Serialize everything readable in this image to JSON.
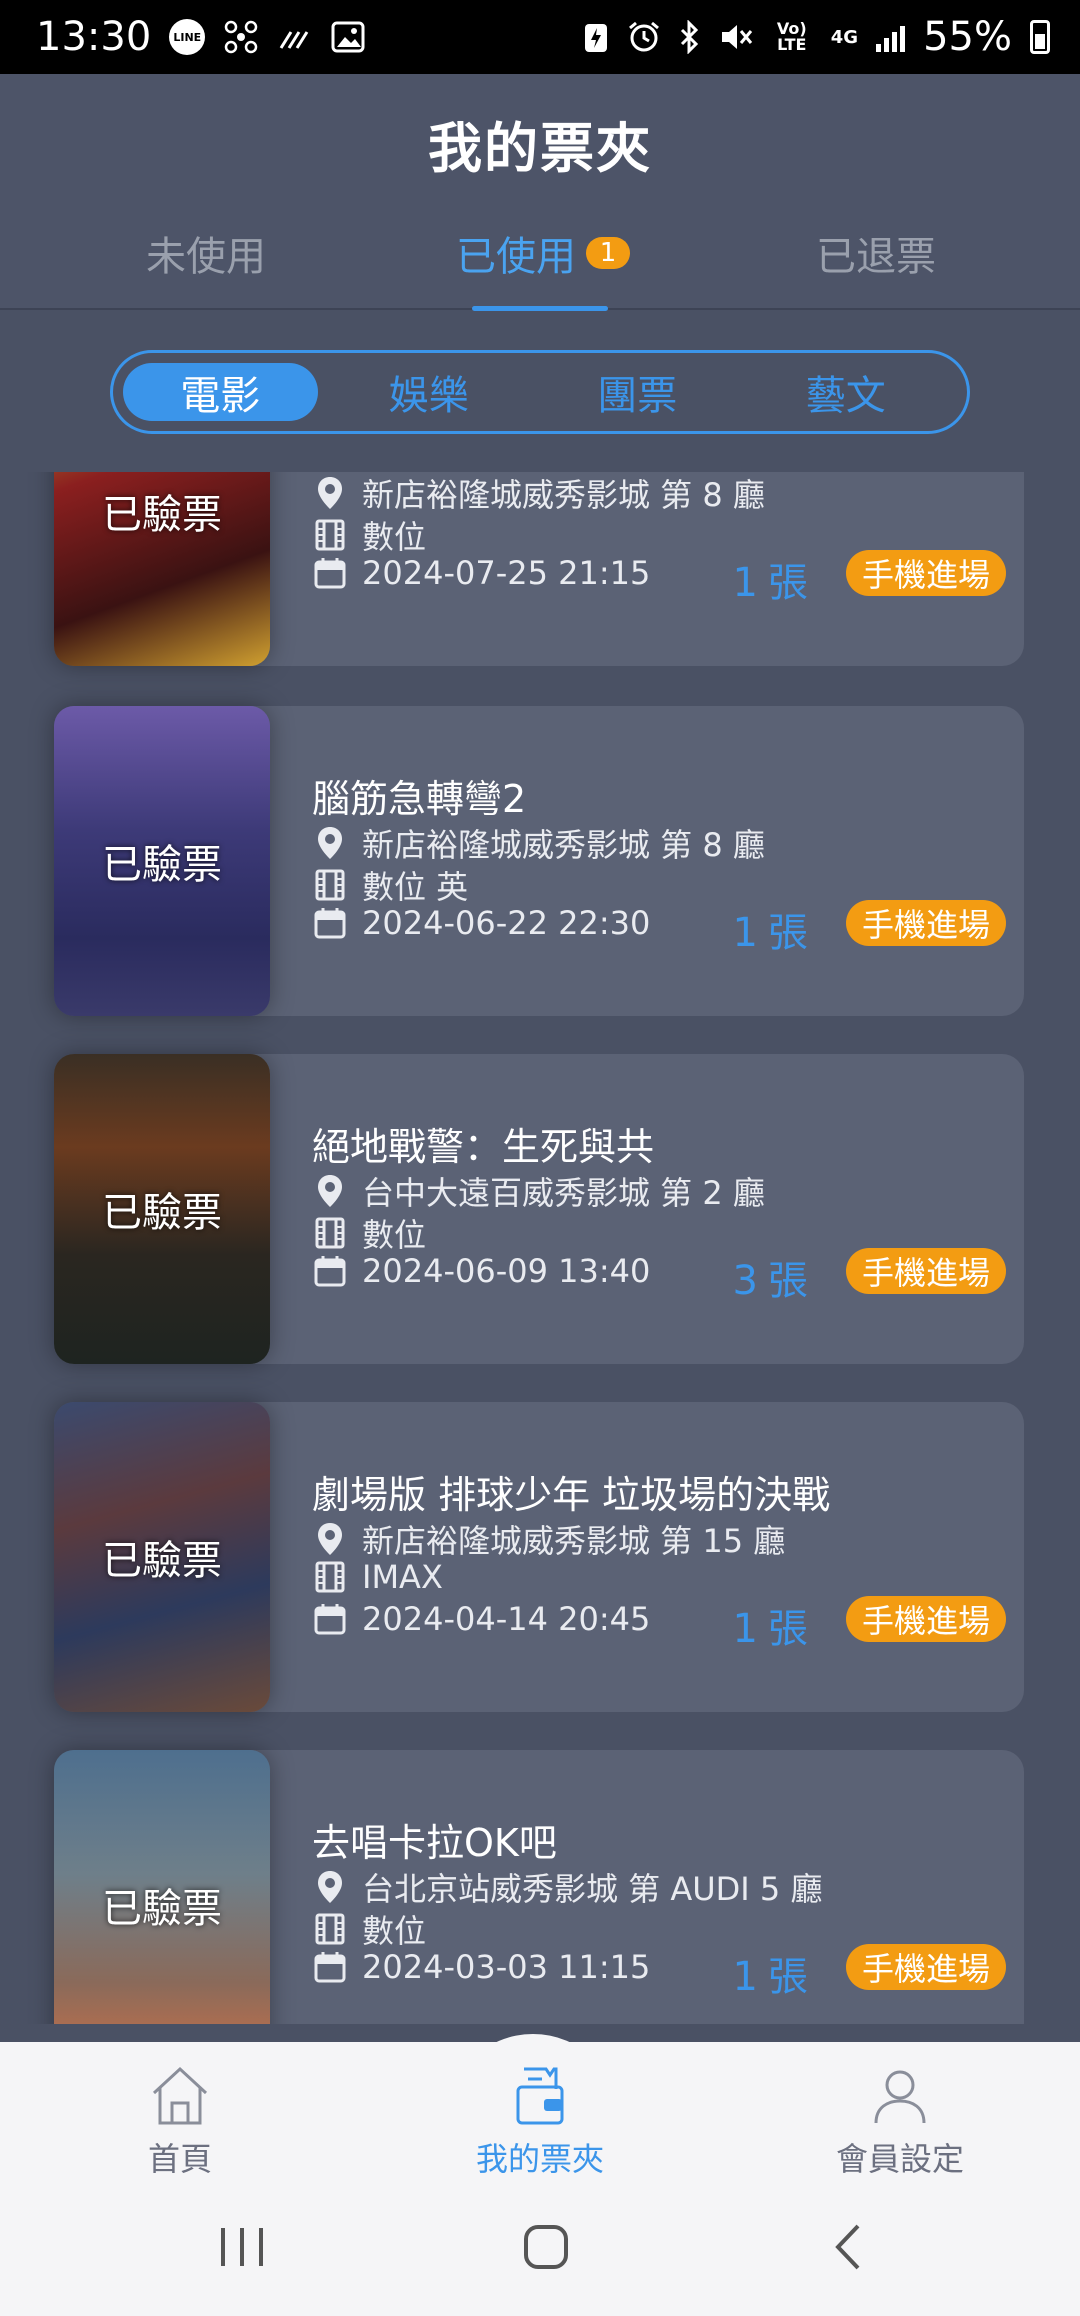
{
  "status_bar": {
    "time": "13:30",
    "line_label": "LINE",
    "battery_percent": "55%",
    "network_type": "4G",
    "volte_label": "Vo) LTE",
    "icons": [
      "line-icon",
      "drone-icon",
      "missed-call-icon",
      "image-icon",
      "battery-saver-icon",
      "alarm-icon",
      "bluetooth-icon",
      "mute-icon",
      "volte-icon",
      "network-4g-icon",
      "signal-icon",
      "battery-icon"
    ]
  },
  "header": {
    "title": "我的票夾",
    "tabs": [
      {
        "label": "未使用"
      },
      {
        "label": "已使用",
        "badge": "1"
      },
      {
        "label": "已退票"
      }
    ],
    "active_tab": "已使用"
  },
  "segment": {
    "items": [
      "電影",
      "娛樂",
      "團票",
      "藝文"
    ],
    "active": "電影"
  },
  "tickets": [
    {
      "title": "",
      "stamp": "已驗票",
      "cinema": "新店裕隆城威秀影城 第 8 廳",
      "format": "數位",
      "datetime": "2024-07-25 21:15",
      "qty": "1",
      "qty_unit": "張",
      "entry": "手機進場"
    },
    {
      "title": "腦筋急轉彎2",
      "stamp": "已驗票",
      "cinema": "新店裕隆城威秀影城 第 8 廳",
      "format": "數位 英",
      "datetime": "2024-06-22 22:30",
      "qty": "1",
      "qty_unit": "張",
      "entry": "手機進場"
    },
    {
      "title": "絕地戰警：生死與共",
      "stamp": "已驗票",
      "cinema": "台中大遠百威秀影城 第 2 廳",
      "format": "數位",
      "datetime": "2024-06-09 13:40",
      "qty": "3",
      "qty_unit": "張",
      "entry": "手機進場"
    },
    {
      "title": "劇場版 排球少年 垃圾場的決戰",
      "stamp": "已驗票",
      "cinema": "新店裕隆城威秀影城 第 15 廳",
      "format": "IMAX",
      "datetime": "2024-04-14 20:45",
      "qty": "1",
      "qty_unit": "張",
      "entry": "手機進場"
    },
    {
      "title": "去唱卡拉OK吧",
      "stamp": "已驗票",
      "cinema": "台北京站威秀影城 第 AUDI 5 廳",
      "format": "數位",
      "datetime": "2024-03-03 11:15",
      "qty": "1",
      "qty_unit": "張",
      "entry": "手機進場"
    }
  ],
  "bottom_nav": {
    "items": [
      {
        "label": "首頁",
        "icon": "home-icon"
      },
      {
        "label": "我的票夾",
        "icon": "ticket-wallet-icon"
      },
      {
        "label": "會員設定",
        "icon": "user-icon"
      }
    ],
    "active": "我的票夾"
  },
  "system_nav": [
    "recent-apps-icon",
    "home-button-icon",
    "back-icon"
  ],
  "colors": {
    "background": "#4a5164",
    "card": "#5b6275",
    "accent_blue": "#3b95ea",
    "badge_orange": "#f39c12",
    "nav_bg": "#f5f5f7"
  }
}
